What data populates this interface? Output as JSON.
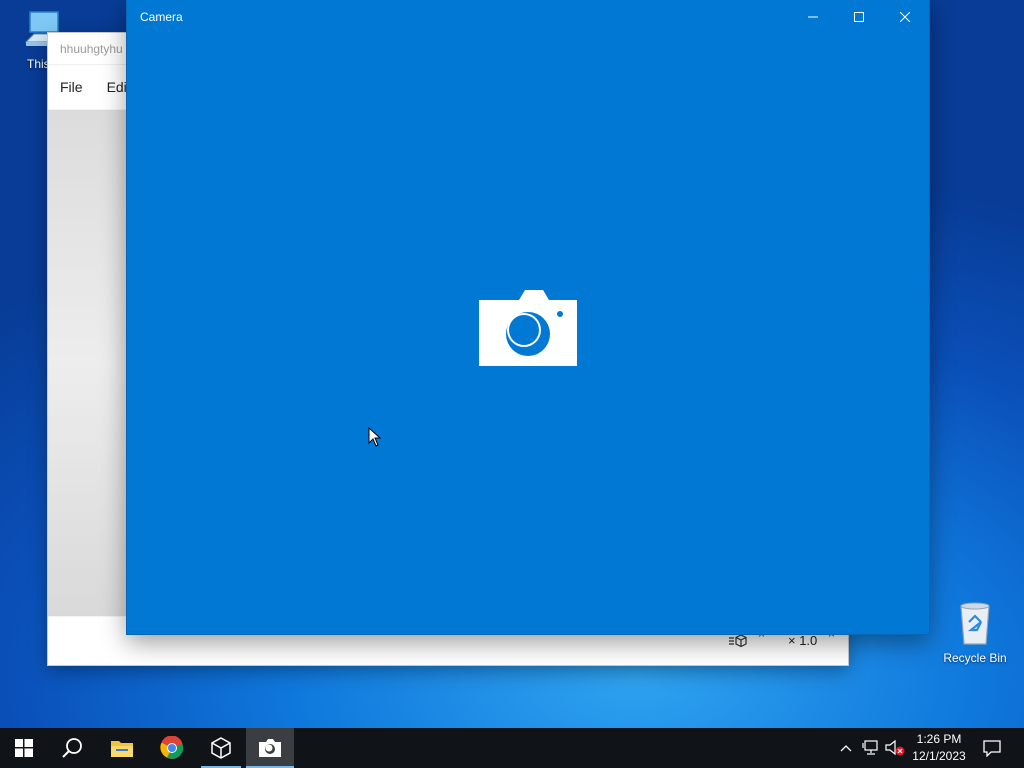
{
  "desktop": {
    "this_pc_label": "This P",
    "recycle_bin_label": "Recycle Bin"
  },
  "background_window": {
    "title": "hhuuhgtyhu",
    "menu": [
      {
        "label": "File"
      },
      {
        "label": "Edit"
      }
    ],
    "status": {
      "zoom_label": "× 1.0"
    }
  },
  "camera_window": {
    "title": "Camera",
    "center_icon": "camera-icon",
    "background_color": "#0078d4"
  },
  "taskbar": {
    "items": [
      {
        "name": "start",
        "icon": "windows-logo-icon"
      },
      {
        "name": "search",
        "icon": "search-icon"
      },
      {
        "name": "file-explorer",
        "icon": "folder-icon"
      },
      {
        "name": "chrome",
        "icon": "chrome-icon"
      },
      {
        "name": "3d-viewer",
        "icon": "cube-icon",
        "running": true
      },
      {
        "name": "camera",
        "icon": "camera-icon",
        "active": true
      }
    ],
    "tray": {
      "time": "1:26 PM",
      "date": "12/1/2023",
      "icons": [
        "chevron-up-icon",
        "network-icon",
        "volume-muted-icon",
        "notifications-icon"
      ]
    }
  }
}
